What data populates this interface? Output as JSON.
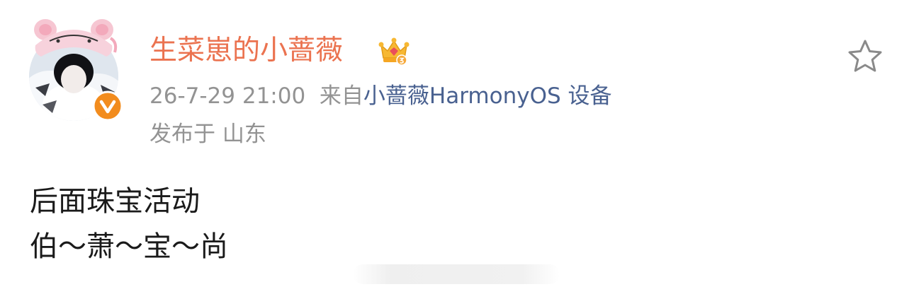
{
  "post": {
    "user_name": "生菜崽的小蔷薇",
    "timestamp": "26-7-29 21:00",
    "source_prefix": "来自",
    "source_device": "小蔷薇HarmonyOS 设备",
    "location": "发布于 山东",
    "content_lines": [
      "后面珠宝活动",
      "伯～萧～宝～尚"
    ]
  },
  "icons": {
    "avatar": "avatar-image",
    "verified": "verified-v-icon",
    "member": "crown-icon",
    "favorite": "star-outline-icon"
  },
  "colors": {
    "user_name": "#eb7350",
    "meta": "#939393",
    "source_link": "#496190",
    "verified_badge": "#f28c1e",
    "text": "#1a1a1a"
  }
}
